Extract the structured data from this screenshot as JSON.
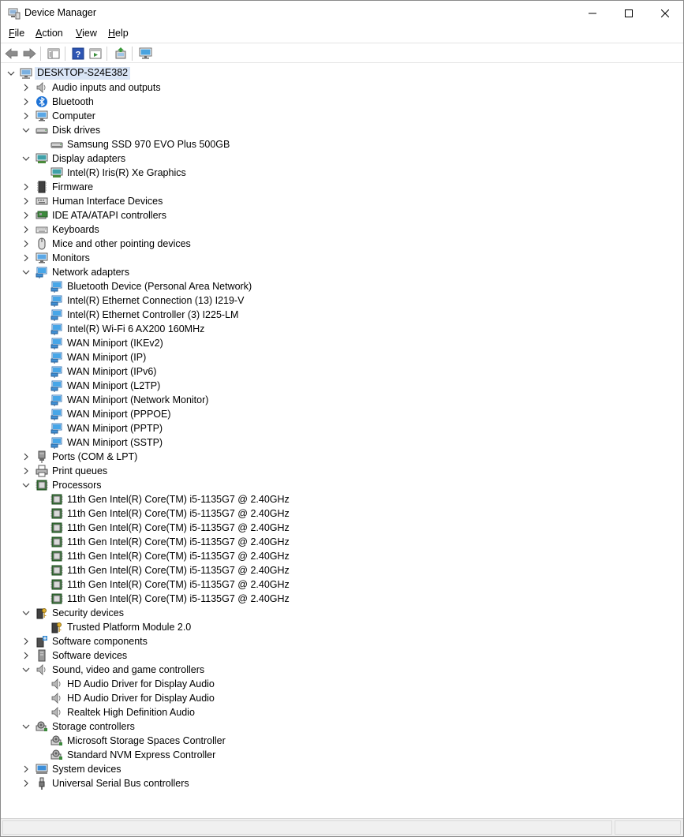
{
  "window": {
    "title": "Device Manager",
    "computer": "DESKTOP-S24E382"
  },
  "menu": [
    {
      "pre": "",
      "acc": "F",
      "post": "ile"
    },
    {
      "pre": "",
      "acc": "A",
      "post": "ction"
    },
    {
      "pre": "",
      "acc": "V",
      "post": "iew"
    },
    {
      "pre": "",
      "acc": "H",
      "post": "elp"
    }
  ],
  "tree": [
    {
      "label": "Audio inputs and outputs",
      "icon": "speaker-icon",
      "expanded": false,
      "children": []
    },
    {
      "label": "Bluetooth",
      "icon": "bluetooth-icon",
      "expanded": false,
      "children": []
    },
    {
      "label": "Computer",
      "icon": "monitor-icon",
      "expanded": false,
      "children": []
    },
    {
      "label": "Disk drives",
      "icon": "disk-drive-icon",
      "expanded": true,
      "children": [
        {
          "label": "Samsung SSD 970 EVO Plus 500GB",
          "icon": "disk-drive-icon"
        }
      ]
    },
    {
      "label": "Display adapters",
      "icon": "display-adapter-icon",
      "expanded": true,
      "children": [
        {
          "label": "Intel(R) Iris(R) Xe Graphics",
          "icon": "display-adapter-icon"
        }
      ]
    },
    {
      "label": "Firmware",
      "icon": "firmware-icon",
      "expanded": false,
      "children": []
    },
    {
      "label": "Human Interface Devices",
      "icon": "hid-icon",
      "expanded": false,
      "children": []
    },
    {
      "label": "IDE ATA/ATAPI controllers",
      "icon": "ide-controller-icon",
      "expanded": false,
      "children": []
    },
    {
      "label": "Keyboards",
      "icon": "keyboard-icon",
      "expanded": false,
      "children": []
    },
    {
      "label": "Mice and other pointing devices",
      "icon": "mouse-icon",
      "expanded": false,
      "children": []
    },
    {
      "label": "Monitors",
      "icon": "monitor-icon",
      "expanded": false,
      "children": []
    },
    {
      "label": "Network adapters",
      "icon": "network-adapter-icon",
      "expanded": true,
      "children": [
        {
          "label": "Bluetooth Device (Personal Area Network)",
          "icon": "network-adapter-icon"
        },
        {
          "label": "Intel(R) Ethernet Connection (13) I219-V",
          "icon": "network-adapter-icon"
        },
        {
          "label": "Intel(R) Ethernet Controller (3) I225-LM",
          "icon": "network-adapter-icon"
        },
        {
          "label": "Intel(R) Wi-Fi 6 AX200 160MHz",
          "icon": "network-adapter-icon"
        },
        {
          "label": "WAN Miniport (IKEv2)",
          "icon": "network-adapter-icon"
        },
        {
          "label": "WAN Miniport (IP)",
          "icon": "network-adapter-icon"
        },
        {
          "label": "WAN Miniport (IPv6)",
          "icon": "network-adapter-icon"
        },
        {
          "label": "WAN Miniport (L2TP)",
          "icon": "network-adapter-icon"
        },
        {
          "label": "WAN Miniport (Network Monitor)",
          "icon": "network-adapter-icon"
        },
        {
          "label": "WAN Miniport (PPPOE)",
          "icon": "network-adapter-icon"
        },
        {
          "label": "WAN Miniport (PPTP)",
          "icon": "network-adapter-icon"
        },
        {
          "label": "WAN Miniport (SSTP)",
          "icon": "network-adapter-icon"
        }
      ]
    },
    {
      "label": "Ports (COM & LPT)",
      "icon": "port-icon",
      "expanded": false,
      "children": []
    },
    {
      "label": "Print queues",
      "icon": "printer-icon",
      "expanded": false,
      "children": []
    },
    {
      "label": "Processors",
      "icon": "processor-icon",
      "expanded": true,
      "children": [
        {
          "label": "11th Gen Intel(R) Core(TM) i5-1135G7 @ 2.40GHz",
          "icon": "processor-icon"
        },
        {
          "label": "11th Gen Intel(R) Core(TM) i5-1135G7 @ 2.40GHz",
          "icon": "processor-icon"
        },
        {
          "label": "11th Gen Intel(R) Core(TM) i5-1135G7 @ 2.40GHz",
          "icon": "processor-icon"
        },
        {
          "label": "11th Gen Intel(R) Core(TM) i5-1135G7 @ 2.40GHz",
          "icon": "processor-icon"
        },
        {
          "label": "11th Gen Intel(R) Core(TM) i5-1135G7 @ 2.40GHz",
          "icon": "processor-icon"
        },
        {
          "label": "11th Gen Intel(R) Core(TM) i5-1135G7 @ 2.40GHz",
          "icon": "processor-icon"
        },
        {
          "label": "11th Gen Intel(R) Core(TM) i5-1135G7 @ 2.40GHz",
          "icon": "processor-icon"
        },
        {
          "label": "11th Gen Intel(R) Core(TM) i5-1135G7 @ 2.40GHz",
          "icon": "processor-icon"
        }
      ]
    },
    {
      "label": "Security devices",
      "icon": "security-device-icon",
      "expanded": true,
      "children": [
        {
          "label": "Trusted Platform Module 2.0",
          "icon": "security-device-icon"
        }
      ]
    },
    {
      "label": "Software components",
      "icon": "software-component-icon",
      "expanded": false,
      "children": []
    },
    {
      "label": "Software devices",
      "icon": "software-device-icon",
      "expanded": false,
      "children": []
    },
    {
      "label": "Sound, video and game controllers",
      "icon": "speaker-icon",
      "expanded": true,
      "children": [
        {
          "label": "HD Audio Driver for Display Audio",
          "icon": "speaker-icon"
        },
        {
          "label": "HD Audio Driver for Display Audio",
          "icon": "speaker-icon"
        },
        {
          "label": "Realtek High Definition Audio",
          "icon": "speaker-icon"
        }
      ]
    },
    {
      "label": "Storage controllers",
      "icon": "storage-controller-icon",
      "expanded": true,
      "children": [
        {
          "label": "Microsoft Storage Spaces Controller",
          "icon": "storage-controller-icon"
        },
        {
          "label": "Standard NVM Express Controller",
          "icon": "storage-controller-icon"
        }
      ]
    },
    {
      "label": "System devices",
      "icon": "system-device-icon",
      "expanded": false,
      "children": []
    },
    {
      "label": "Universal Serial Bus controllers",
      "icon": "usb-icon",
      "expanded": false,
      "children": []
    }
  ]
}
